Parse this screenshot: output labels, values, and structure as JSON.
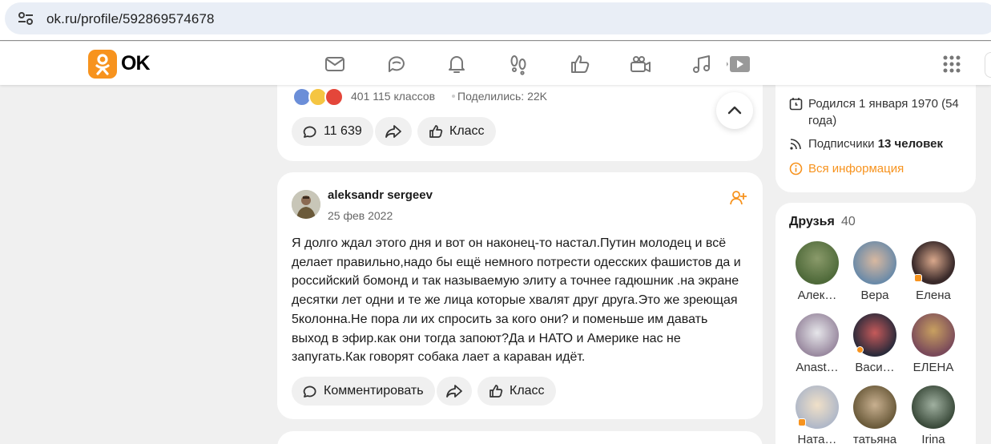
{
  "browser": {
    "url": "ok.ru/profile/592869574678"
  },
  "header": {
    "logo_text": "OK",
    "nav_icons": [
      "messages-icon",
      "discussions-icon",
      "notifications-icon",
      "guests-icon",
      "marks-icon",
      "video-icon",
      "music-icon",
      "games-icon"
    ]
  },
  "post_top": {
    "classes_count": "401 115 классов",
    "shared": "Поделились: 22K",
    "comment_count": "11 639",
    "class_label": "Класс"
  },
  "post": {
    "author": "aleksandr sergeev",
    "date": "25 фев 2022",
    "text": "Я долго ждал этого дня и вот он наконец-то настал.Путин молодец и всё делает правильно,надо бы ещё немного потрести одесских фашистов да и российский  бомонд и так называемую элиту а точнее гадюшник .на экране десятки лет одни и те же лица которые хвалят друг друга.Это же зреющая 5колонна.Не пора ли их спросить за кого они? и поменьше им давать выход в эфир.как они тогда запоют?Да и НАТО  и Америке нас не запугать.Как говорят собака лает а караван идёт.",
    "comment_label": "Комментировать",
    "class_label": "Класс"
  },
  "profile_info": {
    "born": "Родился 1 января 1970 (54 года)",
    "subscribers_label": "Подписчики",
    "subscribers_value": "13 человек",
    "all_info": "Вся информация"
  },
  "friends": {
    "title": "Друзья",
    "count": "40",
    "list": [
      {
        "name": "Алек…"
      },
      {
        "name": "Вера"
      },
      {
        "name": "Елена"
      },
      {
        "name": "Anast…"
      },
      {
        "name": "Васи…"
      },
      {
        "name": "ЕЛЕНА"
      },
      {
        "name": "Ната…"
      },
      {
        "name": "татьяна"
      },
      {
        "name": "Irina"
      }
    ]
  },
  "colors": {
    "brand": "#f7931e",
    "background": "#f0f0f0",
    "card": "#ffffff"
  }
}
